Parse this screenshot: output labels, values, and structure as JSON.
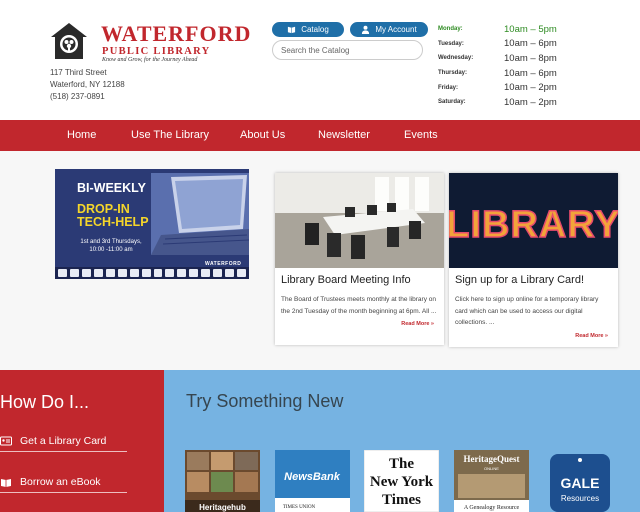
{
  "header": {
    "logo": {
      "title": "WATERFORD",
      "subtitle": "PUBLIC LIBRARY",
      "tagline": "Know and Grow, for the Journey Ahead"
    },
    "address": {
      "street": "117 Third Street",
      "city": "Waterford, NY 12188",
      "phone": "(518) 237-0891"
    },
    "catalog_label": "Catalog",
    "account_label": "My Account",
    "search_placeholder": "Search the Catalog",
    "hours": [
      {
        "day": "Monday:",
        "time": "10am – 5pm",
        "today": true
      },
      {
        "day": "Tuesday:",
        "time": "10am – 6pm"
      },
      {
        "day": "Wednesday:",
        "time": "10am – 8pm"
      },
      {
        "day": "Thursday:",
        "time": "10am – 6pm"
      },
      {
        "day": "Friday:",
        "time": "10am – 2pm"
      },
      {
        "day": "Saturday:",
        "time": "10am – 2pm"
      }
    ],
    "today_color": "#2e8b22"
  },
  "nav": {
    "items": [
      "Home",
      "Use The Library",
      "About Us",
      "Newsletter",
      "Events"
    ]
  },
  "promo": {
    "line1": "BI-WEEKLY",
    "line2": "DROP-IN",
    "line3": "TECH-HELP",
    "schedule": "1st and 3rd Thursdays,",
    "time": "10:00 -11:00 am",
    "brand": "WATERFORD"
  },
  "cards": [
    {
      "title": "Library Board Meeting Info",
      "text": "The Board of Trustees meets monthly at the library on the 2nd Tuesday of the month beginning at 6pm. All ...",
      "more": "Read More »"
    },
    {
      "title": "Sign up for a Library Card!",
      "text": "Click here to sign up online for a temporary library card which can be used to access our digital collections. ...",
      "more": "Read More »",
      "image_word": "LIBRARY"
    }
  ],
  "how_do_i": {
    "title": "How Do I...",
    "items": [
      "Get a Library Card",
      "Borrow an eBook"
    ]
  },
  "try_new": {
    "title": "Try Something New",
    "resources": [
      {
        "name": "Heritagehub",
        "icon": "photo-collage-icon"
      },
      {
        "name": "NewsBank",
        "tagline": "TIMES UNION"
      },
      {
        "name1": "The",
        "name2": "New York",
        "name3": "Times"
      },
      {
        "name": "HeritageQuest",
        "sub": "ONLINE",
        "tagline": "A Genealogy Resource"
      },
      {
        "name": "GALE",
        "sub": "Resources"
      }
    ]
  },
  "colors": {
    "brand_red": "#c1272d",
    "button_blue": "#1f6fa8",
    "try_blue": "#76b3e2",
    "promo_navy": "#2b3a75",
    "promo_yellow": "#f5d62a"
  }
}
